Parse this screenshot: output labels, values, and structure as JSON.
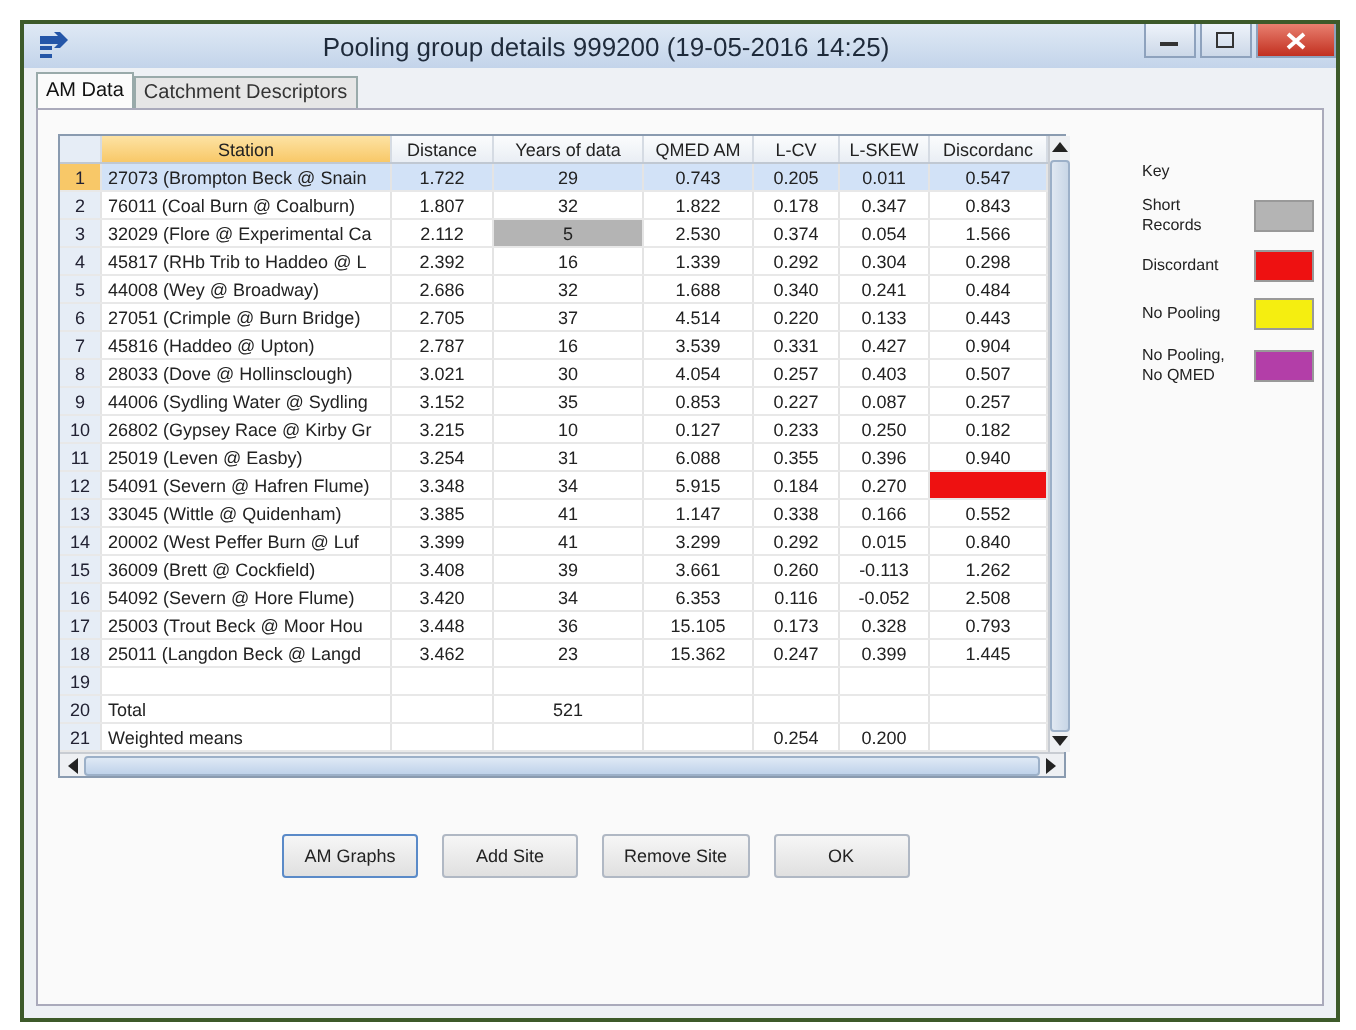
{
  "window": {
    "title": "Pooling group details  999200 (19-05-2016 14:25)"
  },
  "tabs": [
    {
      "label": "AM Data",
      "selected": true
    },
    {
      "label": "Catchment Descriptors",
      "selected": false
    }
  ],
  "table": {
    "columns": [
      "Station",
      "Distance",
      "Years of data",
      "QMED AM",
      "L-CV",
      "L-SKEW",
      "Discordanc"
    ],
    "rows": [
      {
        "number": "1",
        "selected": true,
        "cells": [
          "27073 (Brompton Beck @ Snain",
          "1.722",
          "29",
          "0.743",
          "0.205",
          "0.011",
          "0.547"
        ]
      },
      {
        "number": "2",
        "selected": false,
        "cells": [
          "76011 (Coal Burn @ Coalburn)",
          "1.807",
          "32",
          "1.822",
          "0.178",
          "0.347",
          "0.843"
        ]
      },
      {
        "number": "3",
        "selected": false,
        "short_records": true,
        "cells": [
          "32029 (Flore @ Experimental Ca",
          "2.112",
          "5",
          "2.530",
          "0.374",
          "0.054",
          "1.566"
        ]
      },
      {
        "number": "4",
        "selected": false,
        "cells": [
          "45817 (RHb Trib to Haddeo @ L",
          "2.392",
          "16",
          "1.339",
          "0.292",
          "0.304",
          "0.298"
        ]
      },
      {
        "number": "5",
        "selected": false,
        "cells": [
          "44008 (Wey @ Broadway)",
          "2.686",
          "32",
          "1.688",
          "0.340",
          "0.241",
          "0.484"
        ]
      },
      {
        "number": "6",
        "selected": false,
        "cells": [
          "27051 (Crimple @ Burn Bridge)",
          "2.705",
          "37",
          "4.514",
          "0.220",
          "0.133",
          "0.443"
        ]
      },
      {
        "number": "7",
        "selected": false,
        "cells": [
          "45816 (Haddeo @ Upton)",
          "2.787",
          "16",
          "3.539",
          "0.331",
          "0.427",
          "0.904"
        ]
      },
      {
        "number": "8",
        "selected": false,
        "cells": [
          "28033 (Dove @ Hollinsclough)",
          "3.021",
          "30",
          "4.054",
          "0.257",
          "0.403",
          "0.507"
        ]
      },
      {
        "number": "9",
        "selected": false,
        "cells": [
          "44006 (Sydling Water @ Sydling",
          "3.152",
          "35",
          "0.853",
          "0.227",
          "0.087",
          "0.257"
        ]
      },
      {
        "number": "10",
        "selected": false,
        "cells": [
          "26802 (Gypsey Race @ Kirby Gr",
          "3.215",
          "10",
          "0.127",
          "0.233",
          "0.250",
          "0.182"
        ]
      },
      {
        "number": "11",
        "selected": false,
        "cells": [
          "25019 (Leven @ Easby)",
          "3.254",
          "31",
          "6.088",
          "0.355",
          "0.396",
          "0.940"
        ]
      },
      {
        "number": "12",
        "selected": false,
        "discordant": true,
        "cells": [
          "54091 (Severn @ Hafren Flume)",
          "3.348",
          "34",
          "5.915",
          "0.184",
          "0.270",
          null
        ]
      },
      {
        "number": "13",
        "selected": false,
        "cells": [
          "33045 (Wittle @ Quidenham)",
          "3.385",
          "41",
          "1.147",
          "0.338",
          "0.166",
          "0.552"
        ]
      },
      {
        "number": "14",
        "selected": false,
        "cells": [
          "20002 (West Peffer Burn @ Luf",
          "3.399",
          "41",
          "3.299",
          "0.292",
          "0.015",
          "0.840"
        ]
      },
      {
        "number": "15",
        "selected": false,
        "cells": [
          "36009 (Brett @ Cockfield)",
          "3.408",
          "39",
          "3.661",
          "0.260",
          "-0.113",
          "1.262"
        ]
      },
      {
        "number": "16",
        "selected": false,
        "cells": [
          "54092 (Severn @ Hore Flume)",
          "3.420",
          "34",
          "6.353",
          "0.116",
          "-0.052",
          "2.508"
        ]
      },
      {
        "number": "17",
        "selected": false,
        "cells": [
          "25003 (Trout Beck @ Moor Hou",
          "3.448",
          "36",
          "15.105",
          "0.173",
          "0.328",
          "0.793"
        ]
      },
      {
        "number": "18",
        "selected": false,
        "cells": [
          "25011 (Langdon Beck @ Langd",
          "3.462",
          "23",
          "15.362",
          "0.247",
          "0.399",
          "1.445"
        ]
      },
      {
        "number": "19",
        "selected": false,
        "cells": [
          null,
          null,
          null,
          null,
          null,
          null,
          null
        ]
      },
      {
        "number": "20",
        "selected": false,
        "cells": [
          "Total",
          null,
          "521",
          null,
          null,
          null,
          null
        ]
      },
      {
        "number": "21",
        "selected": false,
        "cells": [
          "Weighted means",
          null,
          null,
          null,
          "0.254",
          "0.200",
          null
        ]
      }
    ]
  },
  "key": {
    "title": "Key",
    "items": [
      {
        "label": "Short Records",
        "color": "#b4b4b4"
      },
      {
        "label": "Discordant",
        "color": "#ee1111"
      },
      {
        "label": "No Pooling",
        "color": "#f5ee10"
      },
      {
        "label": "No Pooling, No QMED",
        "color": "#b33ea8"
      }
    ]
  },
  "buttons": [
    "AM Graphs",
    "Add Site",
    "Remove Site",
    "OK"
  ]
}
